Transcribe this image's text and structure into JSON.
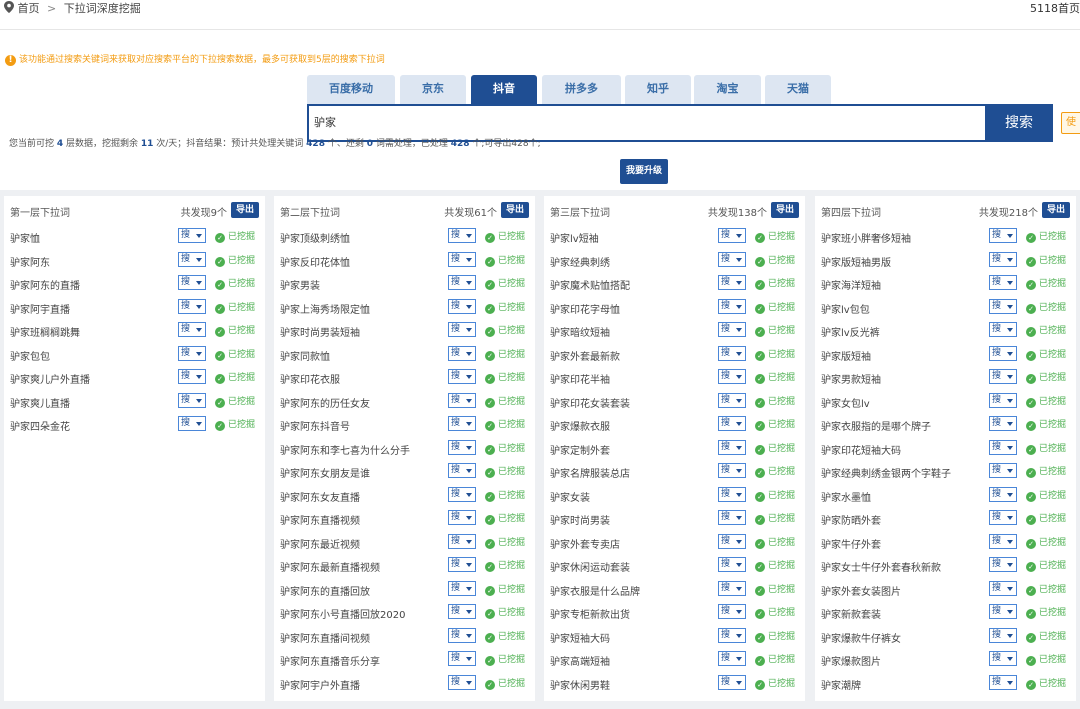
{
  "breadcrumb": {
    "home": "首页",
    "separator": ">",
    "current": "下拉词深度挖掘"
  },
  "site_label": "5118首页",
  "notice": "该功能通过搜索关键词来获取对应搜索平台的下拉搜索数据，最多可获取到5层的搜索下拉词",
  "platform_tabs": [
    {
      "label": "百度移动",
      "active": false
    },
    {
      "label": "京东",
      "active": false
    },
    {
      "label": "抖音",
      "active": true
    },
    {
      "label": "拼多多",
      "active": false
    },
    {
      "label": "知乎",
      "active": false
    },
    {
      "label": "淘宝",
      "active": false
    },
    {
      "label": "天猫",
      "active": false
    }
  ],
  "search": {
    "value": "驴家",
    "button": "搜索",
    "side_tag": "使"
  },
  "stats": {
    "p1": "您当前可挖 ",
    "layers": "4",
    "p2": " 层数据，挖掘剩余 ",
    "remaining": "11",
    "p3": " 次/天；抖音结果：预计共处理关键词 ",
    "expected": "428",
    "p4": " 个、还剩 ",
    "left": "0",
    "p5": " 词需处理，已处理 ",
    "processed": "428",
    "p6": " 个;可导出428个;"
  },
  "upgrade_button": "我要升级",
  "row_controls": {
    "search_select": "搜",
    "status": "已挖掘"
  },
  "columns": [
    {
      "title": "第一层下拉词",
      "count": "共发现9个",
      "export": "导出",
      "keywords": [
        "驴家恤",
        "驴家阿东",
        "驴家阿东的直播",
        "驴家阿宇直播",
        "驴家班榈榈跳舞",
        "驴家包包",
        "驴家爽儿户外直播",
        "驴家爽儿直播",
        "驴家四朵金花"
      ]
    },
    {
      "title": "第二层下拉词",
      "count": "共发现61个",
      "export": "导出",
      "keywords": [
        "驴家顶级刺绣恤",
        "驴家反印花体恤",
        "驴家男装",
        "驴家上海秀场限定恤",
        "驴家时尚男装短袖",
        "驴家同款恤",
        "驴家印花衣服",
        "驴家阿东的历任女友",
        "驴家阿东抖音号",
        "驴家阿东和李七喜为什么分手",
        "驴家阿东女朋友是谁",
        "驴家阿东女友直播",
        "驴家阿东直播视频",
        "驴家阿东最近视频",
        "驴家阿东最新直播视频",
        "驴家阿东的直播回放",
        "驴家阿东小号直播回放2020",
        "驴家阿东直播间视频",
        "驴家阿东直播音乐分享",
        "驴家阿宇户外直播"
      ]
    },
    {
      "title": "第三层下拉词",
      "count": "共发现138个",
      "export": "导出",
      "keywords": [
        "驴家lv短袖",
        "驴家经典刺绣",
        "驴家魔术贴恤搭配",
        "驴家印花字母恤",
        "驴家暗纹短袖",
        "驴家外套最新款",
        "驴家印花半袖",
        "驴家印花女装套装",
        "驴家爆款衣服",
        "驴家定制外套",
        "驴家名牌服装总店",
        "驴家女装",
        "驴家时尚男装",
        "驴家外套专卖店",
        "驴家休闲运动套装",
        "驴家衣服是什么品牌",
        "驴家专柜新款出货",
        "驴家短袖大码",
        "驴家高端短袖",
        "驴家休闲男鞋"
      ]
    },
    {
      "title": "第四层下拉词",
      "count": "共发现218个",
      "export": "导出",
      "keywords": [
        "驴家班小胖奢侈短袖",
        "驴家版短袖男版",
        "驴家海洋短袖",
        "驴家lv包包",
        "驴家lv反光裤",
        "驴家版短袖",
        "驴家男款短袖",
        "驴家女包lv",
        "驴家衣服指的是哪个牌子",
        "驴家印花短袖大码",
        "驴家经典刺绣金银两个字鞋子",
        "驴家水墨恤",
        "驴家防晒外套",
        "驴家牛仔外套",
        "驴家女士牛仔外套春秋新款",
        "驴家外套女装图片",
        "驴家新款套装",
        "驴家爆款牛仔裤女",
        "驴家爆款图片",
        "驴家潮牌"
      ]
    }
  ]
}
